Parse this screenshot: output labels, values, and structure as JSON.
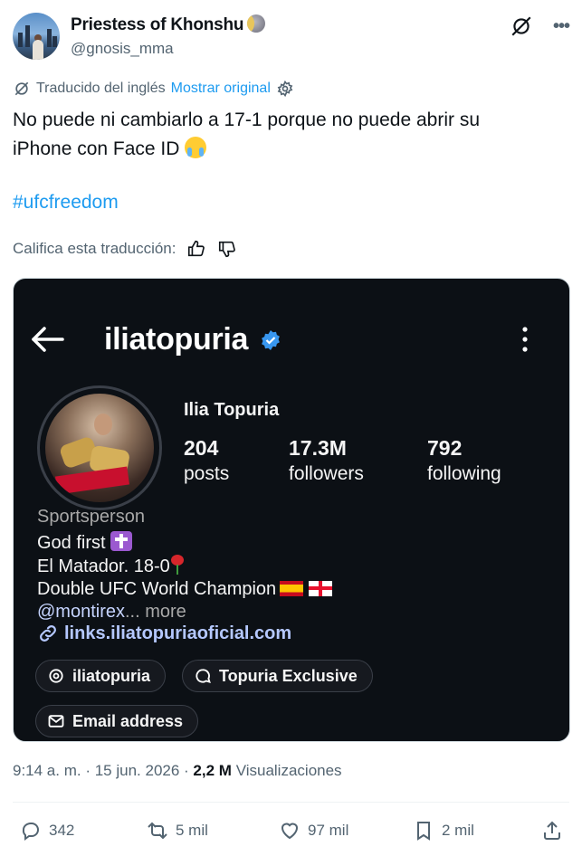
{
  "author": {
    "display_name": "Priestess of Khonshu",
    "handle": "@gnosis_mma"
  },
  "translation": {
    "label": "Traducido del inglés",
    "show_original": "Mostrar original",
    "rate_prompt": "Califica esta traducción:"
  },
  "tweet": {
    "text_line1": "No puede ni cambiarlo a 17-1 porque no puede abrir su",
    "text_line2": "iPhone con Face ID",
    "hashtag": "#ufcfreedom"
  },
  "embedded_profile": {
    "username": "iliatopuria",
    "full_name": "Ilia Topuria",
    "stats": [
      {
        "num": "204",
        "label": "posts"
      },
      {
        "num": "17.3M",
        "label": "followers"
      },
      {
        "num": "792",
        "label": "following"
      }
    ],
    "category": "Sportsperson",
    "bio_line1": "God first",
    "bio_line2": "El Matador. 18-0",
    "bio_line3": "Double UFC World Champion",
    "threads_mention": "@montirex",
    "more": "... more",
    "link": "links.iliatopuriaoficial.com",
    "pill_threads": "iliatopuria",
    "pill_exclusive": "Topuria Exclusive",
    "pill_email": "Email address"
  },
  "meta": {
    "time": "9:14 a. m.",
    "date": "15 jun. 2026",
    "views_count": "2,2 M",
    "views_label": "Visualizaciones"
  },
  "actions": {
    "replies": "342",
    "reposts": "5 mil",
    "likes": "97 mil",
    "bookmarks": "2 mil"
  },
  "colors": {
    "accent": "#1d9bf0",
    "secondary_text": "#536471",
    "card_bg": "#0c1015"
  }
}
